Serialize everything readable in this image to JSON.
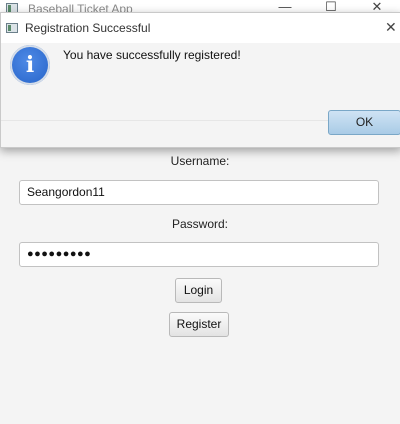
{
  "app": {
    "title": "Baseball Ticket App",
    "window_controls": {
      "minimize": "—",
      "maximize": "☐",
      "close": "✕"
    }
  },
  "form": {
    "username_label": "Username:",
    "username_value": "Seangordon11",
    "password_label": "Password:",
    "password_value": "●●●●●●●●●",
    "login_label": "Login",
    "register_label": "Register"
  },
  "dialog": {
    "title": "Registration Successful",
    "close_glyph": "✕",
    "icon": "info-icon",
    "icon_glyph": "i",
    "message": "You have successfully registered!",
    "ok_label": "OK"
  }
}
